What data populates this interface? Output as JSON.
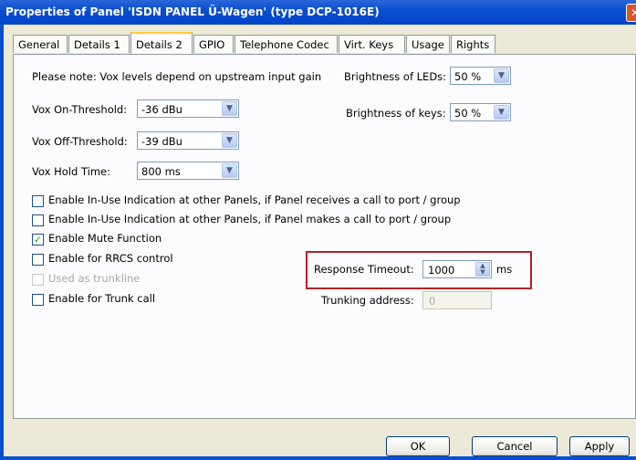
{
  "window": {
    "title": "Properties of Panel 'ISDN PANEL Ü-Wagen' (type DCP-1016E)",
    "close_glyph": "✕"
  },
  "tabs": [
    {
      "label": "General"
    },
    {
      "label": "Details 1"
    },
    {
      "label": "Details 2",
      "active": true
    },
    {
      "label": "GPIO"
    },
    {
      "label": "Telephone Codec"
    },
    {
      "label": "Virt. Keys"
    },
    {
      "label": "Usage"
    },
    {
      "label": "Rights"
    }
  ],
  "details2": {
    "note": "Please note: Vox levels depend on upstream input gain",
    "vox_on": {
      "label": "Vox On-Threshold:",
      "value": "-36 dBu"
    },
    "vox_off": {
      "label": "Vox Off-Threshold:",
      "value": "-39 dBu"
    },
    "vox_hold": {
      "label": "Vox Hold Time:",
      "value": "800 ms"
    },
    "brightness_leds": {
      "label": "Brightness of LEDs:",
      "value": "50 %"
    },
    "brightness_keys": {
      "label": "Brightness of keys:",
      "value": "50 %"
    },
    "checkboxes": [
      {
        "label": "Enable In-Use Indication at other Panels, if Panel receives a call to port / group",
        "checked": false
      },
      {
        "label": "Enable In-Use Indication at other Panels, if Panel makes a call to port / group",
        "checked": false
      },
      {
        "label": "Enable Mute Function",
        "checked": true
      },
      {
        "label": "Enable for RRCS control",
        "checked": false
      },
      {
        "label": "Used as trunkline",
        "checked": false,
        "disabled": true
      },
      {
        "label": "Enable for Trunk call",
        "checked": false
      }
    ],
    "response_timeout": {
      "label": "Response Timeout:",
      "value": "1000",
      "unit": "ms"
    },
    "trunking_address": {
      "label": "Trunking address:",
      "value": "0"
    }
  },
  "buttons": {
    "ok": "OK",
    "cancel": "Cancel",
    "apply": "Apply"
  },
  "glyphs": {
    "check": "✓",
    "dropdown": "▼",
    "spin_up": "▲",
    "spin_down": "▼"
  },
  "colors": {
    "titlebar": "#0a4fd0",
    "highlight_border": "#b22222",
    "check": "#21a121"
  }
}
